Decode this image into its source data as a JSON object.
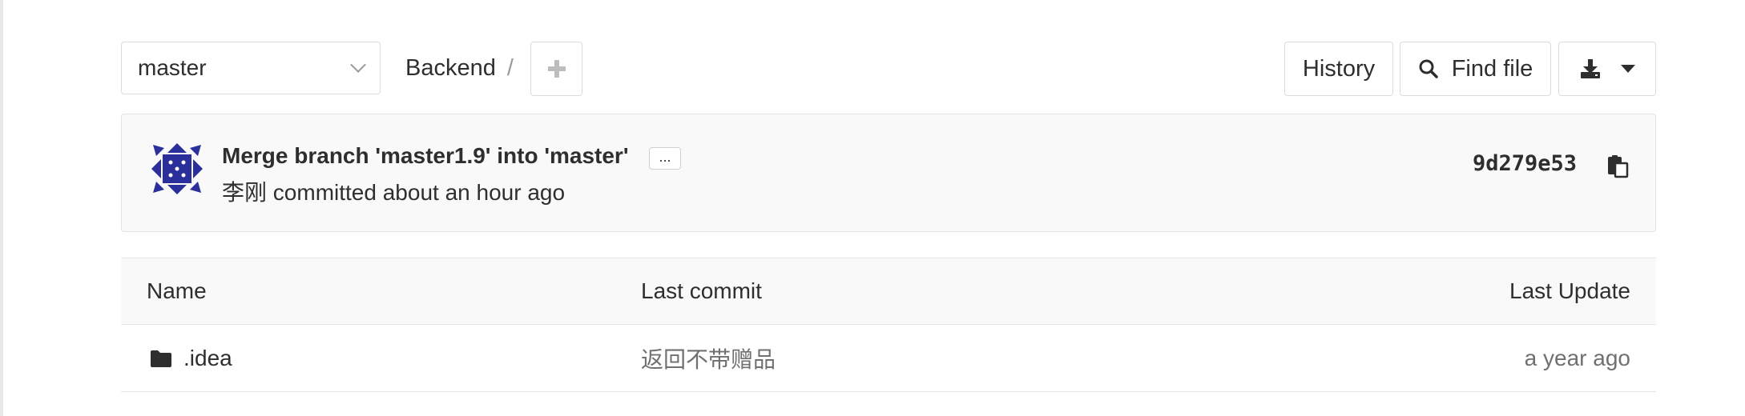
{
  "nav": {
    "branch": "master",
    "breadcrumb": [
      "Backend"
    ],
    "breadcrumb_separator": "/",
    "add_icon": "plus-icon",
    "history_label": "History",
    "find_file_label": "Find file",
    "download_icon": "download-icon",
    "dropdown_icon": "caret-down-icon"
  },
  "commit": {
    "title": "Merge branch 'master1.9' into 'master'",
    "expand_label": "...",
    "author": "李刚",
    "meta": "committed about an hour ago",
    "sha": "9d279e53",
    "copy_icon": "clipboard-icon"
  },
  "table": {
    "headers": {
      "name": "Name",
      "last_commit": "Last commit",
      "last_update": "Last Update"
    },
    "rows": [
      {
        "icon": "folder-icon",
        "name": ".idea",
        "last_commit": "返回不带赠品",
        "last_update": "a year ago"
      }
    ]
  },
  "colors": {
    "border": "#dcdcdc",
    "panel_bg": "#f9f9f9",
    "text": "#2e2e2e",
    "muted_text": "#707070",
    "avatar": "#2a2f9c"
  }
}
